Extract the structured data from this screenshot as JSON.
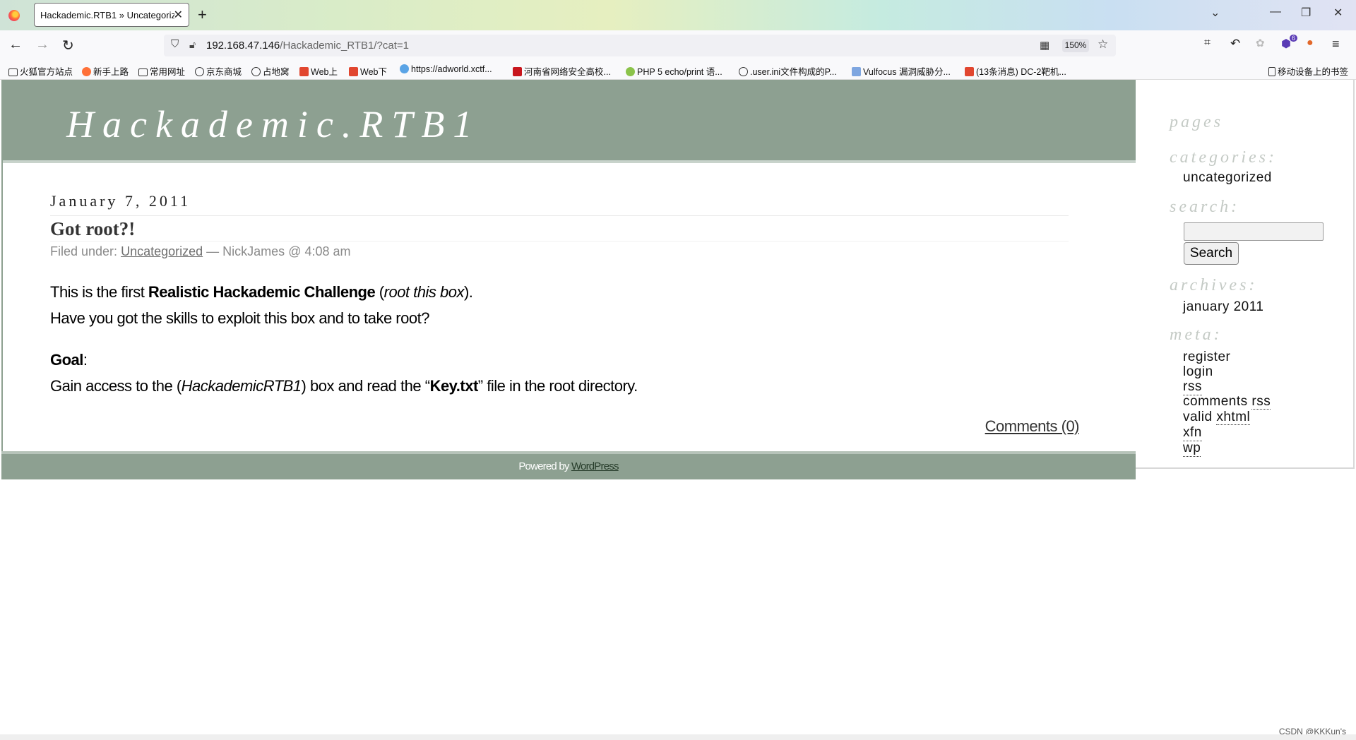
{
  "browser": {
    "tab_title": "Hackademic.RTB1 » Uncategoriz",
    "url_host": "192.168.47.146",
    "url_path": "/Hackademic_RTB1/?cat=1",
    "zoom": "150%",
    "bookmarks": [
      "火狐官方站点",
      "新手上路",
      "常用网址",
      "京东商城",
      "占地窝",
      "Web上",
      "Web下",
      "https://adworld.xctf...",
      "河南省网络安全高校...",
      "PHP 5 echo/print 语...",
      ".user.ini文件构成的P...",
      "Vulfocus 漏洞威胁分...",
      "(13条消息) DC-2靶机...",
      "移动设备上的书签"
    ],
    "extension_badge": "6"
  },
  "blog": {
    "title": "Hackademic.RTB1"
  },
  "post": {
    "date": "January 7, 2011",
    "title": "Got root?!",
    "filed_under_label": "Filed under:",
    "category": "Uncategorized",
    "author_time": "— NickJames @ 4:08 am",
    "body_line1_pre": "This is the first ",
    "body_line1_bold": "Realistic Hackademic Challenge",
    "body_line1_open": " (",
    "body_line1_italic": "root this box",
    "body_line1_close": ").",
    "body_line2": "Have you got the skills to exploit this box and to take root?",
    "goal_label": "Goal",
    "goal_colon": ":",
    "goal_pre": "Gain access to the (",
    "goal_italic": "HackademicRTB1",
    "goal_mid": ") box and read the “",
    "goal_bold": "Key.txt",
    "goal_post": "” file in the root directory.",
    "comments": "Comments (0)"
  },
  "sidebar": {
    "pages_heading": "pages",
    "categories_heading": "categories:",
    "category_item": "uncategorized",
    "search_heading": "search:",
    "search_button": "Search",
    "search_value": "",
    "archives_heading": "archives:",
    "archive_item": "january 2011",
    "meta_heading": "meta:",
    "meta_register": "register",
    "meta_login": "login",
    "meta_rss": "rss",
    "meta_comments": "comments",
    "meta_comments_rss": "rss",
    "meta_valid": "valid",
    "meta_xhtml": "xhtml",
    "meta_xfn": "xfn",
    "meta_wp": "wp"
  },
  "footer": {
    "powered_by": "Powered by ",
    "wordpress": "WordPress"
  },
  "watermark": "CSDN @KKKun's"
}
